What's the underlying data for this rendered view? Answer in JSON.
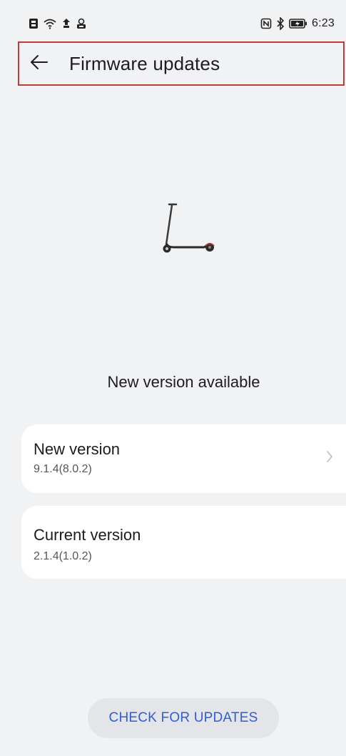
{
  "status_bar": {
    "time": "6:23",
    "left_icons": [
      "sim-icon",
      "wifi-icon",
      "notification-icon",
      "app-icon"
    ],
    "right_icons": [
      "nfc-icon",
      "bluetooth-icon",
      "battery-icon"
    ]
  },
  "header": {
    "title": "Firmware updates",
    "back_icon": "back-arrow-icon"
  },
  "illustration": {
    "icon": "scooter-icon"
  },
  "status_message": "New version available",
  "versions": {
    "new": {
      "label": "New version",
      "value": "9.1.4(8.0.2)"
    },
    "current": {
      "label": "Current version",
      "value": "2.1.4(1.0.2)"
    }
  },
  "check_button_label": "CHECK FOR UPDATES",
  "colors": {
    "background": "#f1f2f4",
    "card": "#ffffff",
    "accent": "#2f5dd9",
    "header_border": "#c23b33",
    "button_bg": "#e4e5e8"
  }
}
